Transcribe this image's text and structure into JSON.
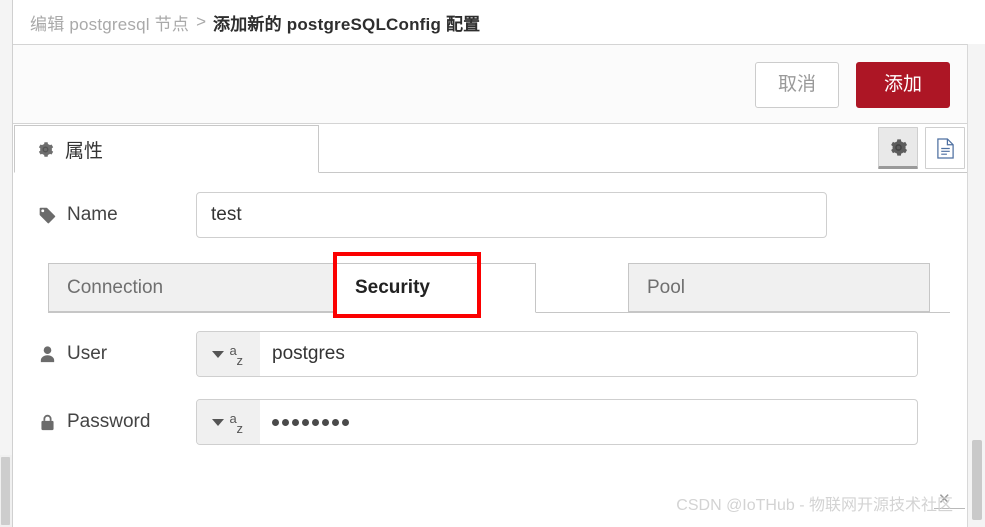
{
  "breadcrumb": {
    "previous": "编辑 postgresql 节点",
    "separator": ">",
    "current": "添加新的 postgreSQLConfig 配置"
  },
  "toolbar": {
    "cancel_label": "取消",
    "add_label": "添加",
    "add_color": "#ad1625"
  },
  "main_tab": {
    "label": "属性",
    "gear_icon": "gear-icon"
  },
  "header_icons": [
    {
      "name": "gear-icon",
      "active": true
    },
    {
      "name": "description-icon",
      "active": false
    }
  ],
  "fields": {
    "name": {
      "label": "Name",
      "icon": "tag-icon",
      "value": "test",
      "placeholder": "Name"
    },
    "user": {
      "label": "User",
      "icon": "user-icon",
      "type_selector": "a-z",
      "value": "postgres",
      "placeholder": "User"
    },
    "password": {
      "label": "Password",
      "icon": "lock-icon",
      "type_selector": "a-z",
      "value": "••••••••",
      "dot_count": 8,
      "placeholder": "Password"
    }
  },
  "subtabs": [
    {
      "label": "Connection",
      "active": false
    },
    {
      "label": "Security",
      "active": true
    },
    {
      "label": "Pool",
      "active": false
    }
  ],
  "annotation": {
    "color": "#fb0000",
    "target": "Security"
  },
  "watermark": {
    "text": "CSDN @IoTHub - 物联网开源技术社区"
  }
}
